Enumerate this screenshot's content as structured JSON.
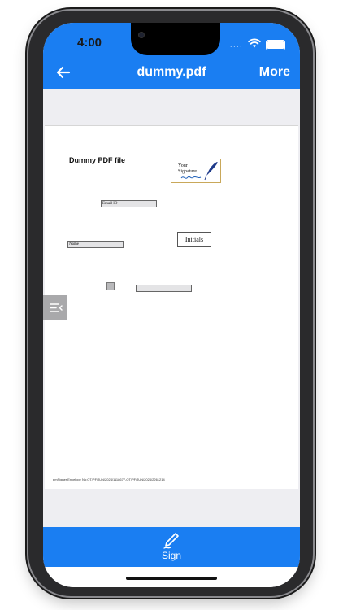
{
  "status_bar": {
    "time": "4:00",
    "signal_dots": "....",
    "icons": [
      "wifi-icon",
      "battery-icon"
    ]
  },
  "nav": {
    "back_icon": "arrow-left-icon",
    "title": "dummy.pdf",
    "more_label": "More"
  },
  "document": {
    "title": "Dummy PDF file",
    "signature_label_line1": "Your",
    "signature_label_line2": "Signature",
    "email_field_label": "Email ID",
    "name_field_label": "Name",
    "initials_label": "Initials",
    "footer_note": "emSigner Envelope No:OT/PF/JUN/2024/1118677-OT/PF/JUN/2024/2261214"
  },
  "sidebar_toggle": {
    "icon": "menu-collapse-icon"
  },
  "bottom_bar": {
    "sign_icon": "pen-icon",
    "sign_label": "Sign"
  },
  "colors": {
    "accent": "#1a7ef2",
    "page_background": "#eeeef2",
    "field_fill": "#e4e4e6",
    "signature_border": "#c9a85a"
  }
}
